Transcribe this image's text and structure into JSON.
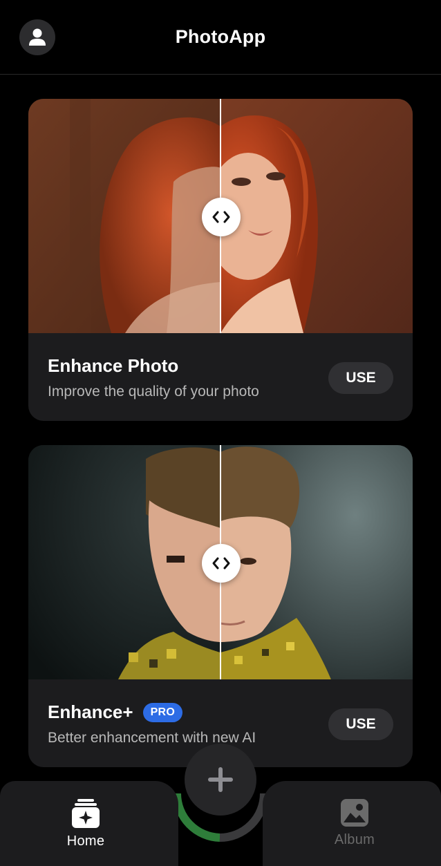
{
  "header": {
    "title": "PhotoApp",
    "profile_icon": "user-icon"
  },
  "cards": [
    {
      "title": "Enhance Photo",
      "description": "Improve the quality of your photo",
      "button_label": "USE",
      "badge": "",
      "compare_icon": "chevrons-left-right-icon"
    },
    {
      "title": "Enhance+",
      "description": "Better enhancement with new AI",
      "button_label": "USE",
      "badge": "PRO",
      "compare_icon": "chevrons-left-right-icon"
    }
  ],
  "bottom_nav": {
    "items": [
      {
        "label": "Home",
        "icon": "photo-stack-sparkle-icon",
        "active": true
      },
      {
        "label": "Album",
        "icon": "image-icon",
        "active": false
      }
    ],
    "fab_icon": "plus-icon"
  },
  "colors": {
    "background": "#000000",
    "card": "#1c1c1e",
    "accent_badge": "#2d6ce5",
    "inactive_nav": "#6b6b6b"
  }
}
